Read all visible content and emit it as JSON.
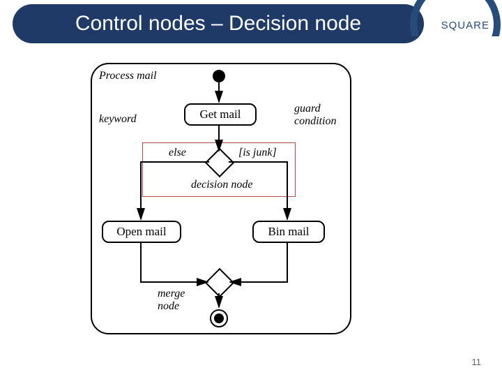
{
  "header": {
    "title": "Control nodes – Decision node",
    "brand": "SQUARE"
  },
  "page_number": "11",
  "diagram": {
    "frame_label": "Process mail",
    "actions": {
      "get": "Get mail",
      "open": "Open mail",
      "bin": "Bin mail"
    },
    "labels": {
      "keyword": "keyword",
      "guard": "guard\ncondition",
      "else": "else",
      "isjunk": "[is junk]",
      "decision": "decision node",
      "merge": "merge\nnode"
    }
  }
}
